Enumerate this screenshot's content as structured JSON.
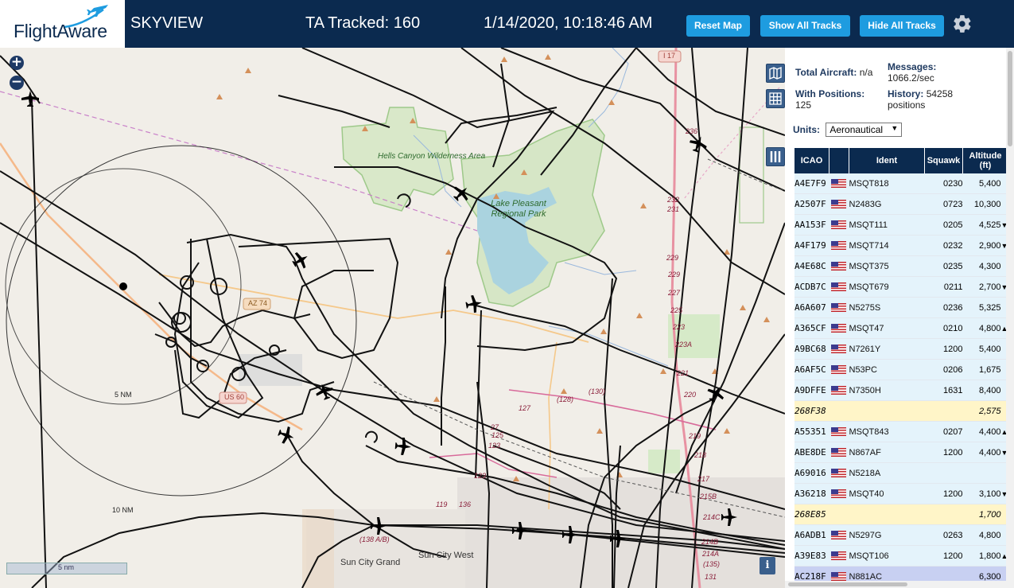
{
  "header": {
    "logo_text": "FlightAware",
    "app_title": "SKYVIEW",
    "tracked": "TA Tracked: 160",
    "datetime": "1/14/2020, 10:18:46 AM",
    "buttons": {
      "reset_map": "Reset Map",
      "show_all": "Show All Tracks",
      "hide_all": "Hide All Tracks"
    },
    "settings_icon": "gear-icon"
  },
  "map": {
    "zoom_in": "+",
    "zoom_out": "−",
    "labels": {
      "hells_canyon": "Hells Canyon Wilderness Area",
      "lake_pleasant": "Lake Pleasant Regional Park",
      "sun_city_grand": "Sun City Grand",
      "sun_city_west": "Sun City West",
      "range_5nm": "5 NM",
      "range_10nm": "10 NM",
      "us60": "US 60",
      "az74": "AZ 74",
      "i17": "I 17"
    },
    "road_numbers": [
      "236",
      "232",
      "231",
      "229",
      "229",
      "227",
      "225",
      "223",
      "223A",
      "221",
      "220",
      "219",
      "218",
      "217",
      "215B",
      "214C",
      "214B",
      "214A",
      "(135)",
      "131",
      "(130)",
      "(128)",
      "127",
      "27",
      "125",
      "123",
      "123",
      "119",
      "136",
      "(138 A/B)"
    ],
    "scale_label": "5 nm",
    "info_button": "i",
    "controls": [
      "map-layers-icon",
      "grid-icon",
      "columns-icon"
    ]
  },
  "panel": {
    "total_aircraft_label": "Total Aircraft:",
    "total_aircraft_value": "n/a",
    "messages_label": "Messages:",
    "messages_value": "1066.2/sec",
    "with_positions_label": "With Positions:",
    "with_positions_value": "125",
    "history_label": "History:",
    "history_value": "54258 positions",
    "units_label": "Units:",
    "units_value": "Aeronautical"
  },
  "table": {
    "headers": {
      "icao": "ICAO",
      "ident": "Ident",
      "squawk": "Squawk",
      "altitude": "Altitude (ft)"
    },
    "rows": [
      {
        "icao": "A4E7F9",
        "flag": true,
        "ident": "MSQT818",
        "squawk": "0230",
        "alt": "5,400",
        "trend": "",
        "type": "normal"
      },
      {
        "icao": "A2507F",
        "flag": true,
        "ident": "N2483G",
        "squawk": "0723",
        "alt": "10,300",
        "trend": "",
        "type": "normal"
      },
      {
        "icao": "AA153F",
        "flag": true,
        "ident": "MSQT111",
        "squawk": "0205",
        "alt": "4,525",
        "trend": "▼",
        "type": "normal"
      },
      {
        "icao": "A4F179",
        "flag": true,
        "ident": "MSQT714",
        "squawk": "0232",
        "alt": "2,900",
        "trend": "▼",
        "type": "normal"
      },
      {
        "icao": "A4E68C",
        "flag": true,
        "ident": "MSQT375",
        "squawk": "0235",
        "alt": "4,300",
        "trend": "",
        "type": "normal"
      },
      {
        "icao": "ACDB7C",
        "flag": true,
        "ident": "MSQT679",
        "squawk": "0211",
        "alt": "2,700",
        "trend": "▼",
        "type": "normal"
      },
      {
        "icao": "A6A607",
        "flag": true,
        "ident": "N5275S",
        "squawk": "0236",
        "alt": "5,325",
        "trend": "",
        "type": "normal"
      },
      {
        "icao": "A365CF",
        "flag": true,
        "ident": "MSQT47",
        "squawk": "0210",
        "alt": "4,800",
        "trend": "▲",
        "type": "normal"
      },
      {
        "icao": "A9BC68",
        "flag": true,
        "ident": "N7261Y",
        "squawk": "1200",
        "alt": "5,400",
        "trend": "",
        "type": "normal"
      },
      {
        "icao": "A6AF5C",
        "flag": true,
        "ident": "N53PC",
        "squawk": "0206",
        "alt": "1,675",
        "trend": "",
        "type": "normal"
      },
      {
        "icao": "A9DFFE",
        "flag": true,
        "ident": "N7350H",
        "squawk": "1631",
        "alt": "8,400",
        "trend": "",
        "type": "normal"
      },
      {
        "icao": "268F38",
        "flag": false,
        "ident": "",
        "squawk": "",
        "alt": "2,575",
        "trend": "",
        "type": "mlat"
      },
      {
        "icao": "A55351",
        "flag": true,
        "ident": "MSQT843",
        "squawk": "0207",
        "alt": "4,400",
        "trend": "▲",
        "type": "normal"
      },
      {
        "icao": "ABE8DE",
        "flag": true,
        "ident": "N867AF",
        "squawk": "1200",
        "alt": "4,400",
        "trend": "▼",
        "type": "normal"
      },
      {
        "icao": "A69016",
        "flag": true,
        "ident": "N5218A",
        "squawk": "",
        "alt": "",
        "trend": "",
        "type": "normal"
      },
      {
        "icao": "A36218",
        "flag": true,
        "ident": "MSQT40",
        "squawk": "1200",
        "alt": "3,100",
        "trend": "▼",
        "type": "normal"
      },
      {
        "icao": "268E85",
        "flag": false,
        "ident": "",
        "squawk": "",
        "alt": "1,700",
        "trend": "",
        "type": "mlat"
      },
      {
        "icao": "A6ADB1",
        "flag": true,
        "ident": "N5297G",
        "squawk": "0263",
        "alt": "4,800",
        "trend": "",
        "type": "normal"
      },
      {
        "icao": "A39E83",
        "flag": true,
        "ident": "MSQT106",
        "squawk": "1200",
        "alt": "1,800",
        "trend": "▲",
        "type": "normal"
      },
      {
        "icao": "AC218F",
        "flag": true,
        "ident": "N881AC",
        "squawk": "",
        "alt": "6,300",
        "trend": "",
        "type": "selected"
      }
    ]
  }
}
